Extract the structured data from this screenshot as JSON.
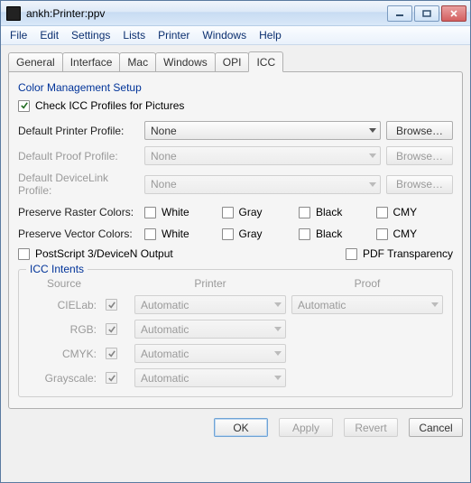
{
  "window": {
    "title": "ankh:Printer:ppv"
  },
  "menubar": [
    "File",
    "Edit",
    "Settings",
    "Lists",
    "Printer",
    "Windows",
    "Help"
  ],
  "tabs": [
    "General",
    "Interface",
    "Mac",
    "Windows",
    "OPI",
    "ICC"
  ],
  "active_tab": "ICC",
  "section": {
    "title": "Color Management Setup",
    "check_profiles": "Check ICC Profiles for Pictures",
    "printer_profile_label": "Default Printer Profile:",
    "printer_profile_value": "None",
    "proof_profile_label": "Default Proof Profile:",
    "proof_profile_value": "None",
    "devicelink_label": "Default DeviceLink Profile:",
    "devicelink_value": "None",
    "browse": "Browse…",
    "preserve_raster": "Preserve Raster Colors:",
    "preserve_vector": "Preserve Vector Colors:",
    "colors": {
      "white": "White",
      "gray": "Gray",
      "black": "Black",
      "cmy": "CMY"
    },
    "ps3": "PostScript 3/DeviceN Output",
    "pdftrans": "PDF Transparency"
  },
  "intents": {
    "legend": "ICC Intents",
    "headers": {
      "source": "Source",
      "printer": "Printer",
      "proof": "Proof"
    },
    "rows": [
      {
        "label": "CIELab:",
        "printer": "Automatic",
        "proof": "Automatic"
      },
      {
        "label": "RGB:",
        "printer": "Automatic",
        "proof": ""
      },
      {
        "label": "CMYK:",
        "printer": "Automatic",
        "proof": ""
      },
      {
        "label": "Grayscale:",
        "printer": "Automatic",
        "proof": ""
      }
    ]
  },
  "footer": {
    "ok": "OK",
    "apply": "Apply",
    "revert": "Revert",
    "cancel": "Cancel"
  }
}
